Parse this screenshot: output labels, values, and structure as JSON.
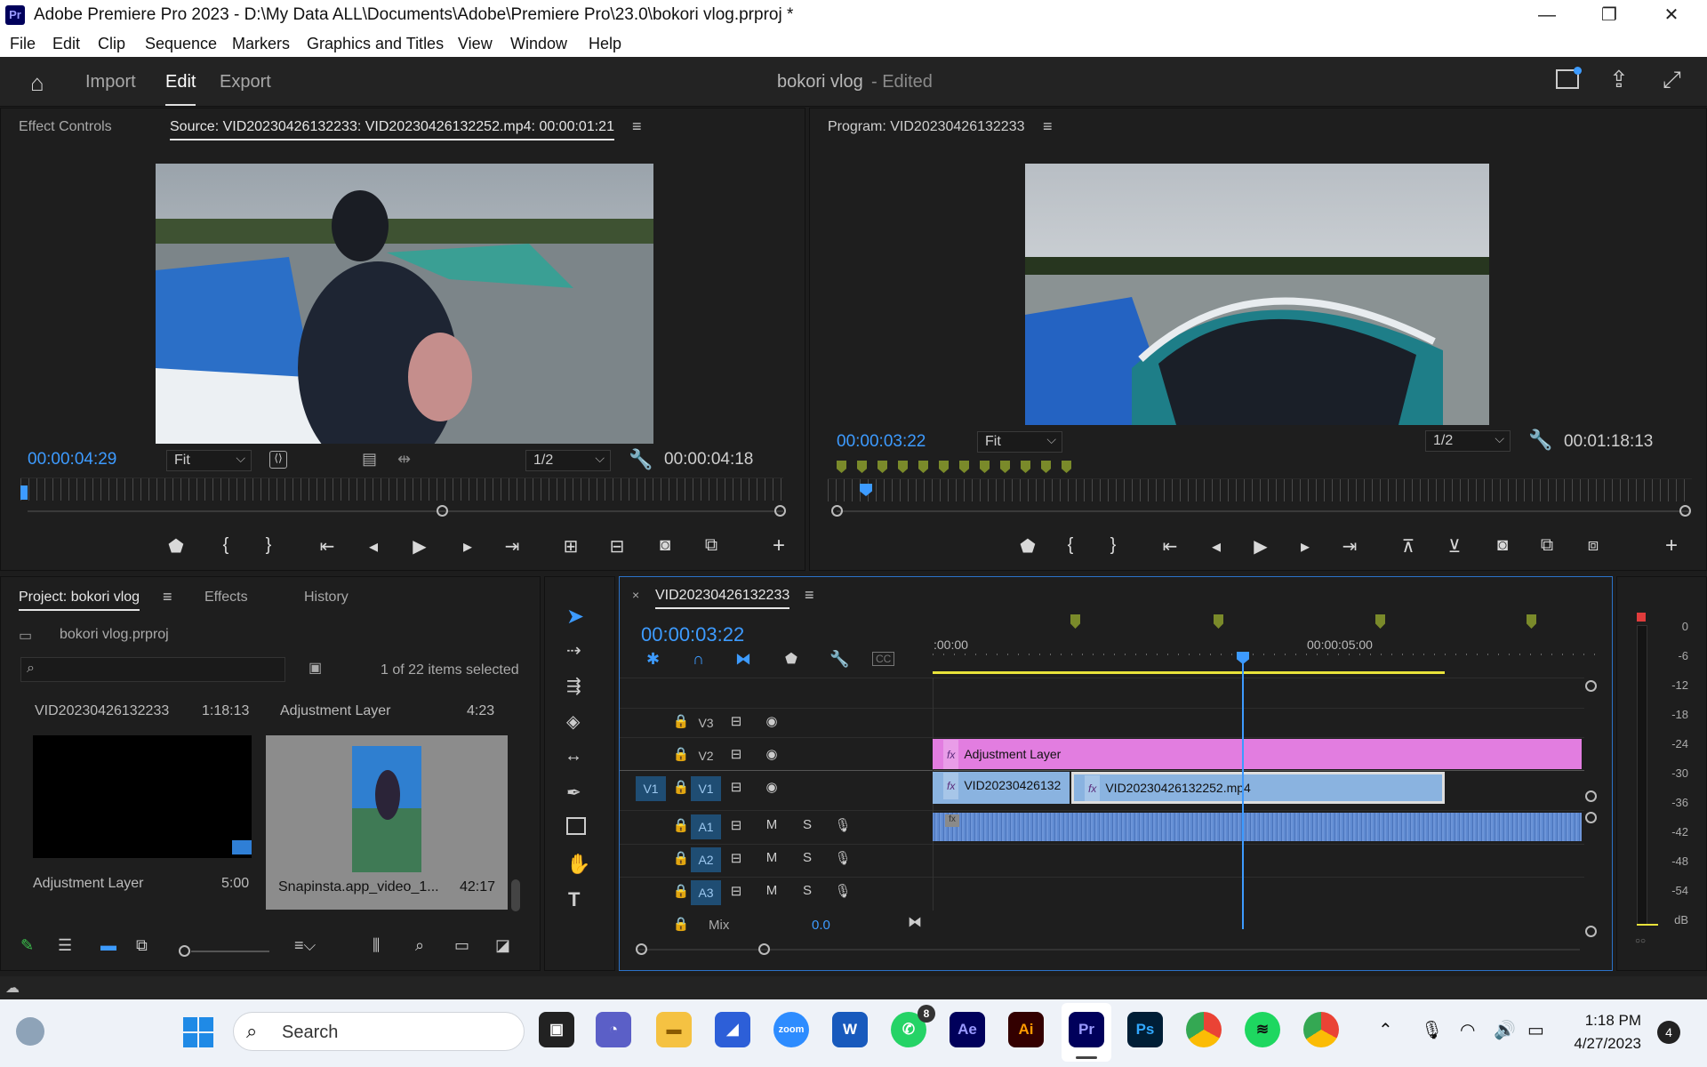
{
  "window": {
    "app_icon": "Pr",
    "title": "Adobe Premiere Pro 2023 - D:\\My Data ALL\\Documents\\Adobe\\Premiere Pro\\23.0\\bokori vlog.prproj *"
  },
  "menu": [
    "File",
    "Edit",
    "Clip",
    "Sequence",
    "Markers",
    "Graphics and Titles",
    "View",
    "Window",
    "Help"
  ],
  "header": {
    "tabs": [
      "Import",
      "Edit",
      "Export"
    ],
    "active_tab": "Edit",
    "project_name": "bokori vlog",
    "project_status": "- Edited"
  },
  "source": {
    "tab_effect_controls": "Effect Controls",
    "tab_source": "Source: VID20230426132233: VID20230426132252.mp4: 00:00:01:21",
    "timecode": "00:00:04:29",
    "zoom": "Fit",
    "resolution": "1/2",
    "duration": "00:00:04:18"
  },
  "program": {
    "tab": "Program: VID20230426132233",
    "timecode": "00:00:03:22",
    "zoom": "Fit",
    "resolution": "1/2",
    "duration": "00:01:18:13"
  },
  "project": {
    "tabs": [
      "Project: bokori vlog",
      "Effects",
      "History"
    ],
    "file": "bokori vlog.prproj",
    "selection": "1 of 22 items selected",
    "search_placeholder": "",
    "items": [
      {
        "name": "VID20230426132233",
        "duration": "1:18:13"
      },
      {
        "name": "Adjustment Layer",
        "duration": "4:23"
      },
      {
        "name": "Adjustment Layer",
        "duration": "5:00"
      },
      {
        "name": "Snapinsta.app_video_1...",
        "duration": "42:17"
      }
    ]
  },
  "timeline": {
    "tab": "VID20230426132233",
    "timecode": "00:00:03:22",
    "ruler_labels": [
      ":00:00",
      "00:00:05:00"
    ],
    "video_tracks": [
      "V3",
      "V2",
      "V1"
    ],
    "source_patch": "V1",
    "audio_tracks": [
      "A1",
      "A2",
      "A3"
    ],
    "mute": "M",
    "solo": "S",
    "mix_label": "Mix",
    "mix_value": "0.0",
    "clips": {
      "adjustment": "Adjustment Layer",
      "v1_a": "VID20230426132",
      "v1_b": "VID20230426132252.mp4",
      "fx": "fx"
    }
  },
  "meter": {
    "scale": [
      "0",
      "-6",
      "-12",
      "-18",
      "-24",
      "-30",
      "-36",
      "-42",
      "-48",
      "-54",
      "dB"
    ]
  },
  "taskbar": {
    "search": "Search",
    "whatsapp_badge": "8",
    "time": "1:18 PM",
    "date": "4/27/2023",
    "notifications": "4",
    "apps": [
      "Ae",
      "Ai",
      "Pr",
      "Ps",
      "W",
      "zoom"
    ]
  },
  "colors": {
    "accent_blue": "#3d9bff",
    "adjustment_clip": "#e27de0",
    "video_clip": "#8ab3e0",
    "audio_clip": "#5f8ad1"
  }
}
